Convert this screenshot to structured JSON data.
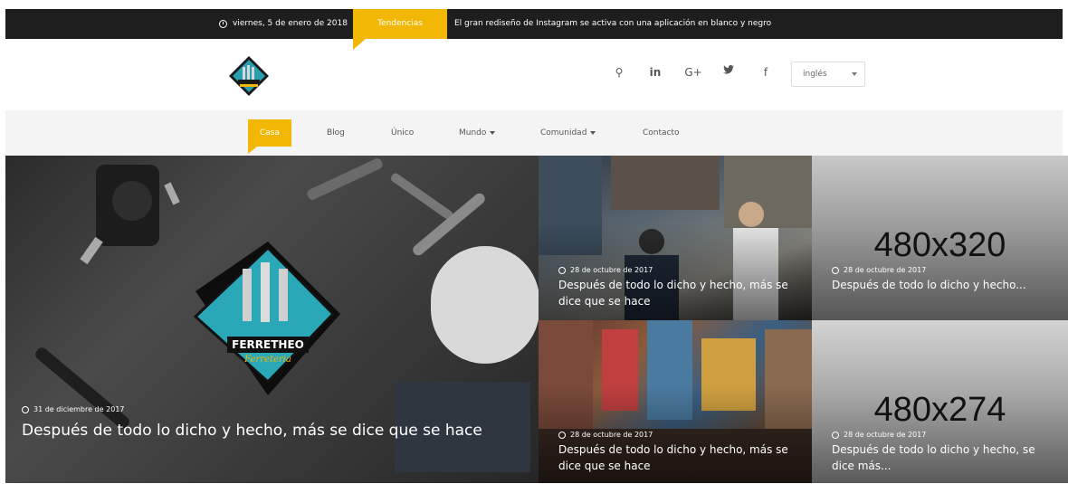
{
  "topbar": {
    "date": "viernes, 5 de enero de 2018",
    "trending_label": "Tendencias",
    "ticker": "El gran rediseño de Instagram se activa con una aplicación en blanco y negro"
  },
  "header": {
    "logo_icon": "ferretheo-logo",
    "social": [
      {
        "icon": "search-icon",
        "glyph": "⚲"
      },
      {
        "icon": "linkedin-icon",
        "glyph": "in"
      },
      {
        "icon": "google-plus-icon",
        "glyph": "G+"
      },
      {
        "icon": "twitter-icon",
        "glyph": "🐦"
      },
      {
        "icon": "facebook-icon",
        "glyph": "f"
      }
    ],
    "language": "inglés"
  },
  "nav": {
    "items": [
      {
        "label": "Casa",
        "active": true
      },
      {
        "label": "Blog"
      },
      {
        "label": "Único"
      },
      {
        "label": "Mundo",
        "dropdown": true
      },
      {
        "label": "Comunidad",
        "dropdown": true
      },
      {
        "label": "Contacto"
      }
    ]
  },
  "posts": [
    {
      "date": "31 de diciembre de 2017",
      "title": "Después de todo lo dicho y hecho, más se dice que se hace",
      "logo_top": "FERRETHEO",
      "logo_bottom": "Ferreteria"
    },
    {
      "date": "28 de octubre de 2017",
      "title": "Después de todo lo dicho y hecho, más se dice que se hace"
    },
    {
      "date": "28 de octubre de 2017",
      "title": "Después de todo lo dicho y hecho...",
      "placeholder": "480x320"
    },
    {
      "date": "28 de octubre de 2017",
      "title": "Después de todo lo dicho y hecho, más se dice que se hace"
    },
    {
      "date": "28 de octubre de 2017",
      "title": "Después de todo lo dicho y hecho, se dice más...",
      "placeholder": "480x274"
    }
  ],
  "colors": {
    "accent": "#f2b705",
    "dark": "#1e1e1e",
    "nav_bg": "#f4f4f4"
  }
}
